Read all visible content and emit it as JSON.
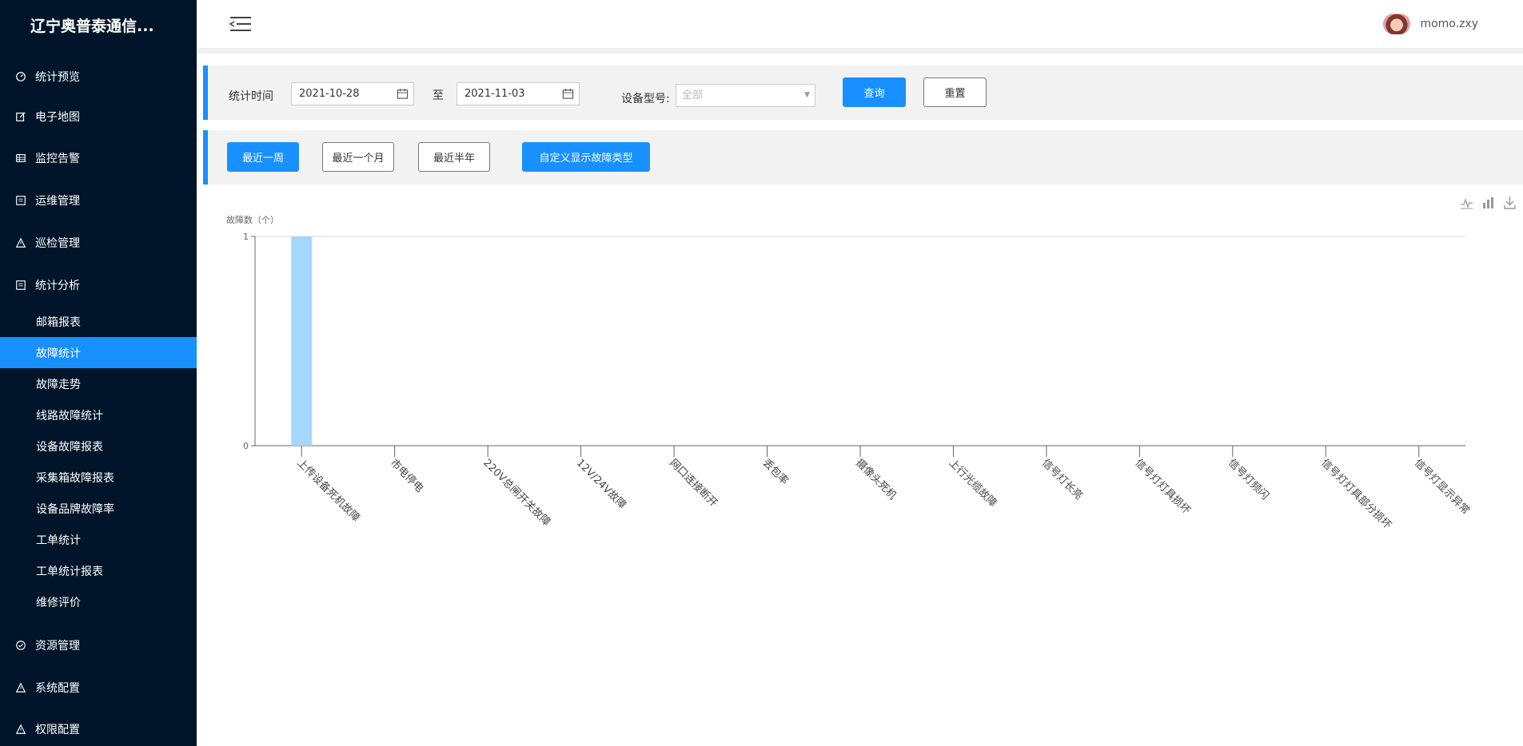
{
  "app": {
    "brand": "辽宁奥普泰通信..."
  },
  "sidebar": {
    "items": [
      {
        "label": "统计预览",
        "icon": "dashboard-icon"
      },
      {
        "label": "电子地图",
        "icon": "edit-icon"
      },
      {
        "label": "监控告警",
        "icon": "table-icon"
      },
      {
        "label": "运维管理",
        "icon": "list-icon"
      },
      {
        "label": "巡检管理",
        "icon": "warning-icon"
      },
      {
        "label": "统计分析",
        "icon": "list-icon"
      },
      {
        "label": "资源管理",
        "icon": "check-circle-icon"
      },
      {
        "label": "系统配置",
        "icon": "warning-icon"
      },
      {
        "label": "权限配置",
        "icon": "warning-icon"
      }
    ],
    "sub_items": [
      "邮箱报表",
      "故障统计",
      "故障走势",
      "线路故障统计",
      "设备故障报表",
      "采集箱故障报表",
      "设备品牌故障率",
      "工单统计",
      "工单统计报表",
      "维修评价"
    ],
    "active_sub": "故障统计"
  },
  "header": {
    "username": "momo.zxy"
  },
  "filters": {
    "time_label": "统计时间",
    "start_date": "2021-10-28",
    "to_label": "至",
    "end_date": "2021-11-03",
    "device_label": "设备型号:",
    "device_value": "全部",
    "query_button": "查询",
    "reset_button": "重置"
  },
  "quick": {
    "week": "最近一周",
    "month": "最近一个月",
    "half_year": "最近半年",
    "custom": "自定义显示故障类型"
  },
  "colors": {
    "accent": "#1890ff",
    "sidebar_bg": "#001529",
    "bar": "#a5d6fb"
  },
  "chart_data": {
    "type": "bar",
    "ylabel": "故障数（个）",
    "ylim": [
      0,
      1
    ],
    "yticks": [
      0,
      1
    ],
    "categories": [
      "上传设备死机故障",
      "市电停电",
      "220V总闸开关故障",
      "12V/24V故障",
      "网口连接断开",
      "丢包率",
      "摄像头死机",
      "上行光缆故障",
      "信号灯长亮",
      "信号灯灯具损坏",
      "信号灯频闪",
      "信号灯灯具部分损坏",
      "信号灯显示异常"
    ],
    "values": [
      1,
      0,
      0,
      0,
      0,
      0,
      0,
      0,
      0,
      0,
      0,
      0,
      0
    ]
  }
}
